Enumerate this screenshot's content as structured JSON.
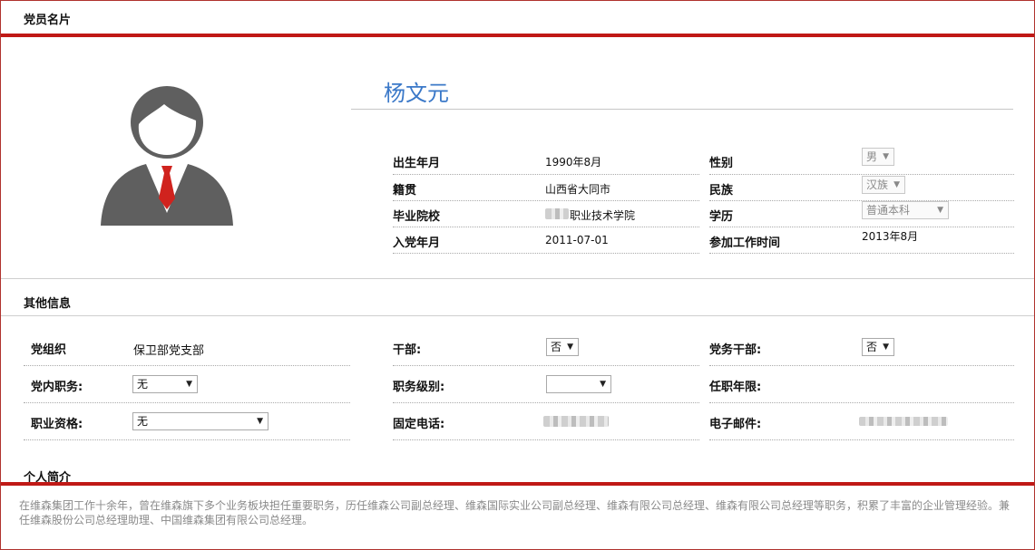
{
  "header": {
    "title": "党员名片"
  },
  "profile": {
    "name": "杨文元",
    "fields": {
      "birth_label": "出生年月",
      "birth_value": "1990年8月",
      "gender_label": "性别",
      "gender_value": "男",
      "native_label": "籍贯",
      "native_value": "山西省大同市",
      "ethnic_label": "民族",
      "ethnic_value": "汉族",
      "school_label": "毕业院校",
      "school_value": "职业技术学院",
      "edu_label": "学历",
      "edu_value": "普通本科",
      "join_label": "入党年月",
      "join_value": "2011-07-01",
      "work_label": "参加工作时间",
      "work_value": "2013年8月"
    }
  },
  "other": {
    "title": "其他信息",
    "org_label": "党组织",
    "org_value": "保卫部党支部",
    "cadre_label": "干部:",
    "cadre_value": "否",
    "party_cadre_label": "党务干部:",
    "party_cadre_value": "否",
    "party_duty_label": "党内职务:",
    "party_duty_value": "无",
    "duty_level_label": "职务级别:",
    "duty_level_value": "",
    "tenure_label": "任职年限:",
    "qualification_label": "职业资格:",
    "qualification_value": "无",
    "phone_label": "固定电话:",
    "email_label": "电子邮件:"
  },
  "bio": {
    "title": "个人简介",
    "text": "在维森集团工作十余年，曾在维森旗下多个业务板块担任重要职务，历任维森公司副总经理、维森国际实业公司副总经理、维森有限公司总经理、维森有限公司总经理等职务，积累了丰富的企业管理经验。兼任维森股份公司总经理助理、中国维森集团有限公司总经理。"
  },
  "colors": {
    "accent_red": "#c01916",
    "name_blue": "#3a78c8"
  },
  "icons": {
    "avatar": "user-avatar-icon",
    "dropdown": "chevron-down-icon"
  }
}
